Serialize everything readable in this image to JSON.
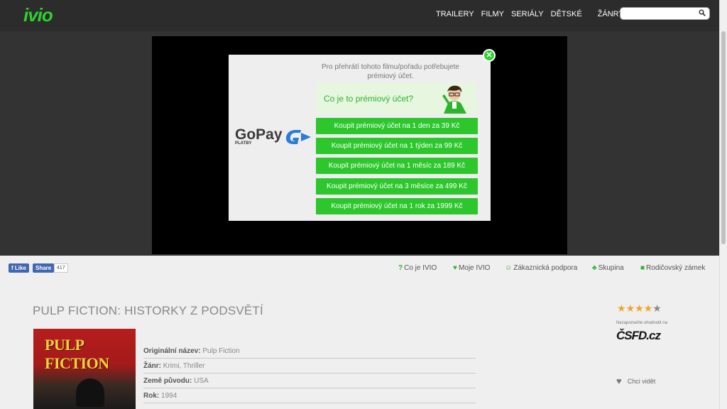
{
  "header": {
    "logo": "ivio",
    "nav": [
      "TRAILERY",
      "FILMY",
      "SERIÁLY",
      "DĚTSKÉ"
    ],
    "zanry": "ŽÁNRY",
    "search_placeholder": ""
  },
  "modal": {
    "message": "Pro přehrátí tohoto filmu/pořadu potřebujete prémiový účet.",
    "premium_question": "Co je to prémiový účet?",
    "gopay_brand": "GoPay",
    "gopay_sub": "PLATBY",
    "buttons": [
      "Koupit prémiový účet na 1 den za 39 Kč",
      "Koupit prémiový účet na 1 týden za 99 Kč",
      "Koupit prémiový účet na 1 měsíc za 189 Kč",
      "Koupit prémiový účet na 3 měsíce za 499 Kč",
      "Koupit prémiový účet na 1 rok za 1999 Kč"
    ]
  },
  "social": {
    "like": "Like",
    "share": "Share",
    "count": "417"
  },
  "toolbar": {
    "links": [
      "Co je IVIO",
      "Moje IVIO",
      "Zákaznická podpora",
      "Skupina",
      "Rodičovský zámek"
    ]
  },
  "movie": {
    "title": "PULP FICTION: HISTORKY Z PODSVĚTÍ",
    "poster_title": "PULP FICTION",
    "details": [
      {
        "label": "Originální název:",
        "value": "Pulp Fiction"
      },
      {
        "label": "Žánr:",
        "value": "Krimi, Thriller"
      },
      {
        "label": "Země původu:",
        "value": "USA"
      },
      {
        "label": "Rok:",
        "value": "1994"
      }
    ]
  },
  "sidebar": {
    "rating_stars": 4.5,
    "csfd_note": "Nezapomeňte ohodnotit na",
    "csfd_logo": "ČSFD.cz",
    "wishlist": "Chci vidět"
  },
  "colors": {
    "accent": "#2dc72d",
    "header_bg": "#2c2c2c",
    "facebook": "#4267b2",
    "star": "#f0a32a"
  }
}
